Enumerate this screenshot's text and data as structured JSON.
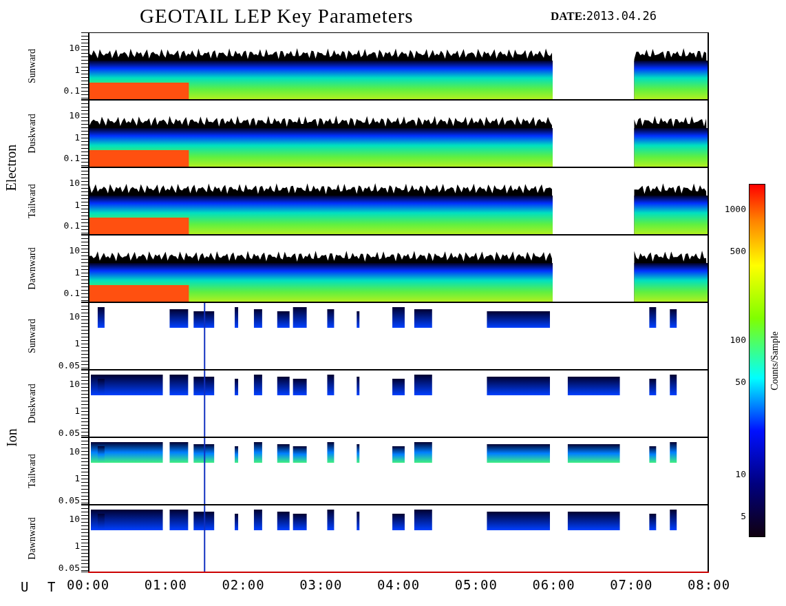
{
  "title": "GEOTAIL LEP Key Parameters",
  "date": {
    "label": "DATE:",
    "value": "2013.04.26"
  },
  "groups": [
    {
      "label": "Electron",
      "kind": "electron",
      "panels": [
        {
          "label": "Sunward",
          "yticks": [
            "10",
            "1",
            "0.1"
          ]
        },
        {
          "label": "Duskward",
          "yticks": [
            "10",
            "1",
            "0.1"
          ]
        },
        {
          "label": "Tailward",
          "yticks": [
            "10",
            "1",
            "0.1"
          ]
        },
        {
          "label": "Dawnward",
          "yticks": [
            "10",
            "1",
            "0.1"
          ]
        }
      ]
    },
    {
      "label": "Ion",
      "kind": "ion",
      "panels": [
        {
          "label": "Sunward",
          "yticks": [
            "10",
            "1",
            "0.05"
          ]
        },
        {
          "label": "Duskward",
          "yticks": [
            "10",
            "1",
            "0.05"
          ]
        },
        {
          "label": "Tailward",
          "yticks": [
            "10",
            "1",
            "0.05"
          ]
        },
        {
          "label": "Dawnward",
          "yticks": [
            "10",
            "1",
            "0.05"
          ]
        }
      ]
    }
  ],
  "x_axis": {
    "label": "U T",
    "ticks": [
      "00:00",
      "01:00",
      "02:00",
      "03:00",
      "04:00",
      "05:00",
      "06:00",
      "07:00",
      "08:00"
    ]
  },
  "colorbar": {
    "label": "Counts/Sample",
    "ticks": [
      "1000",
      "500",
      "100",
      "50",
      "10",
      "5"
    ]
  }
}
